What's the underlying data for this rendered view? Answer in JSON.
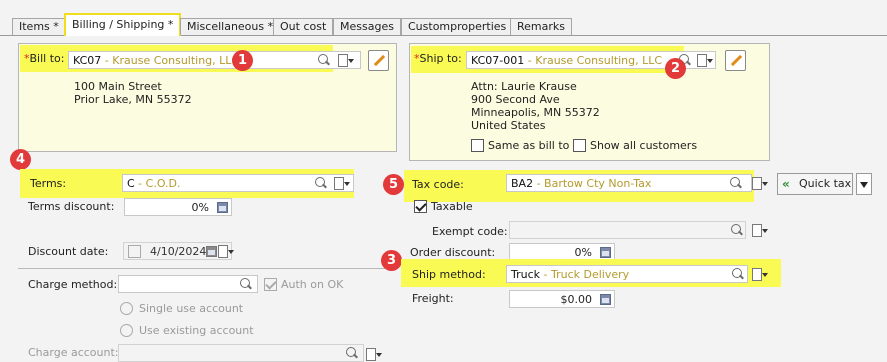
{
  "tabs": [
    "Items *",
    "Billing / Shipping *",
    "Miscellaneous *",
    "Out cost",
    "Messages",
    "Customproperties",
    "Remarks"
  ],
  "bill_to": {
    "label": "Bill to:",
    "code": "KC07",
    "desc": " - Krause Consulting, LLC",
    "address": [
      "100 Main Street",
      "Prior Lake, MN 55372"
    ]
  },
  "ship_to": {
    "label": "Ship to:",
    "code": "KC07-001",
    "desc": " - Krause Consulting, LLC",
    "address": [
      "Attn: Laurie Krause",
      "900 Second Ave",
      "Minneapolis, MN 55372",
      "United States"
    ],
    "same_as_bill": "Same as bill to",
    "show_all": "Show all customers"
  },
  "left": {
    "terms_label": "Terms:",
    "terms_code": "C",
    "terms_desc": " - C.O.D.",
    "terms_discount_label": "Terms discount:",
    "terms_discount_value": "0%",
    "discount_date_label": "Discount date:",
    "discount_date_value": "4/10/2024",
    "charge_method_label": "Charge method:",
    "auth_on_ok": "Auth on OK",
    "single_use": "Single use account",
    "use_existing": "Use existing account",
    "charge_account_label": "Charge account:"
  },
  "right": {
    "tax_code_label": "Tax code:",
    "tax_code": "BA2",
    "tax_desc": " - Bartow Cty Non-Tax",
    "taxable": "Taxable",
    "quick_tax": "Quick tax",
    "exempt_code_label": "Exempt code:",
    "order_discount_label": "Order discount:",
    "order_discount_value": "0%",
    "ship_method_label": "Ship method:",
    "ship_method_code": "Truck",
    "ship_method_desc": " - Truck Delivery",
    "freight_label": "Freight:",
    "freight_value": "$0.00"
  },
  "callouts": [
    "1",
    "2",
    "3",
    "4",
    "5"
  ],
  "colors": {
    "highlight": "#fafa55",
    "callout": "#e23a3a",
    "panel": "#fcfce0"
  }
}
